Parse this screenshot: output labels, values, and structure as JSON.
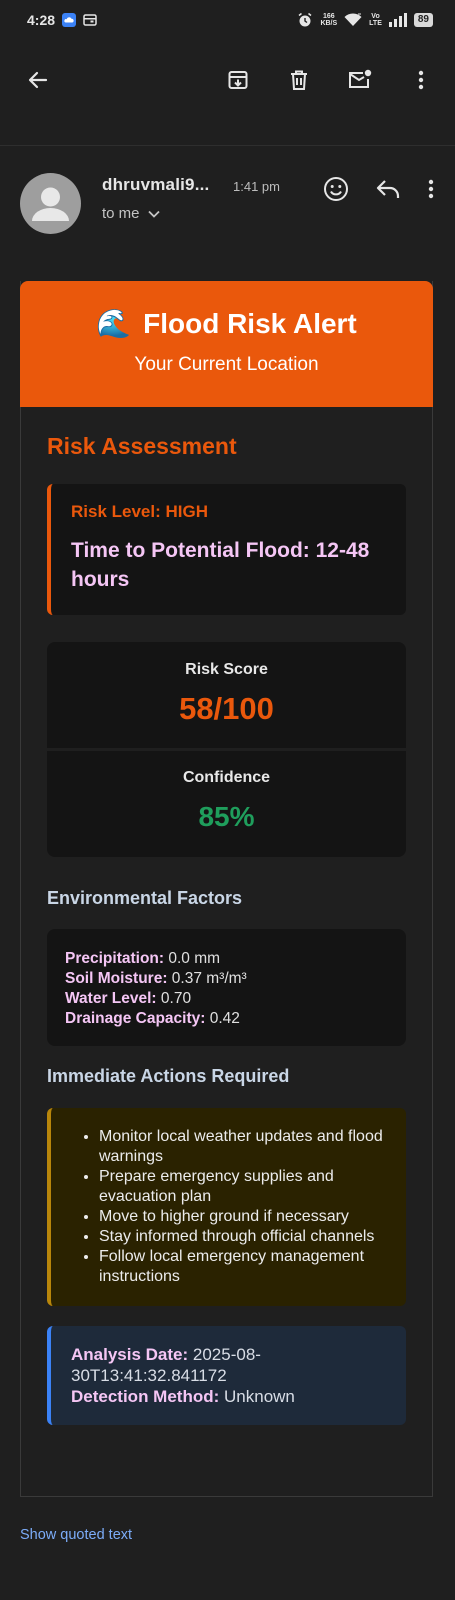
{
  "status_bar": {
    "time": "4:28",
    "net_speed_top": "166",
    "net_speed_bottom": "KB/S",
    "volte_top": "Vo",
    "volte_bottom": "LTE",
    "battery": "89"
  },
  "toolbar": {
    "icons": [
      "back-arrow-icon",
      "archive-icon",
      "delete-icon",
      "mark-unread-icon",
      "more-vert-icon"
    ]
  },
  "email": {
    "sender": "dhruvmali9...",
    "time": "1:41 pm",
    "recipient": "to me"
  },
  "alert": {
    "title": "Flood Risk Alert",
    "emoji": "🌊",
    "subtitle": "Your Current Location",
    "risk_assessment_heading": "Risk Assessment",
    "risk_level": "Risk Level: HIGH",
    "time_to_flood": "Time to Potential Flood: 12-48 hours",
    "risk_score_label": "Risk Score",
    "risk_score_value": "58/100",
    "confidence_label": "Confidence",
    "confidence_value": "85%",
    "env_heading": "Environmental Factors",
    "factors": [
      {
        "label": "Precipitation:",
        "value": " 0.0 mm"
      },
      {
        "label": "Soil Moisture:",
        "value": " 0.37 m³/m³"
      },
      {
        "label": "Water Level:",
        "value": " 0.70"
      },
      {
        "label": "Drainage Capacity:",
        "value": " 0.42"
      }
    ],
    "actions_heading": "Immediate Actions Required",
    "actions": [
      "Monitor local weather updates and flood warnings",
      "Prepare emergency supplies and evacuation plan",
      "Move to higher ground if necessary",
      "Stay informed through official channels",
      "Follow local emergency management instructions"
    ],
    "analysis_date_label": "Analysis Date:",
    "analysis_date_value": " 2025-08-30T13:41:32.841172",
    "detection_method_label": "Detection Method:",
    "detection_method_value": " Unknown"
  },
  "footer": {
    "show_quoted": "Show quoted text"
  },
  "colors": {
    "background": "#1f1f1f",
    "alert_orange": "#ea580c",
    "confidence_green": "#1f9e5c",
    "label_pink": "#f5c6f5",
    "link_blue": "#7cacf8"
  }
}
